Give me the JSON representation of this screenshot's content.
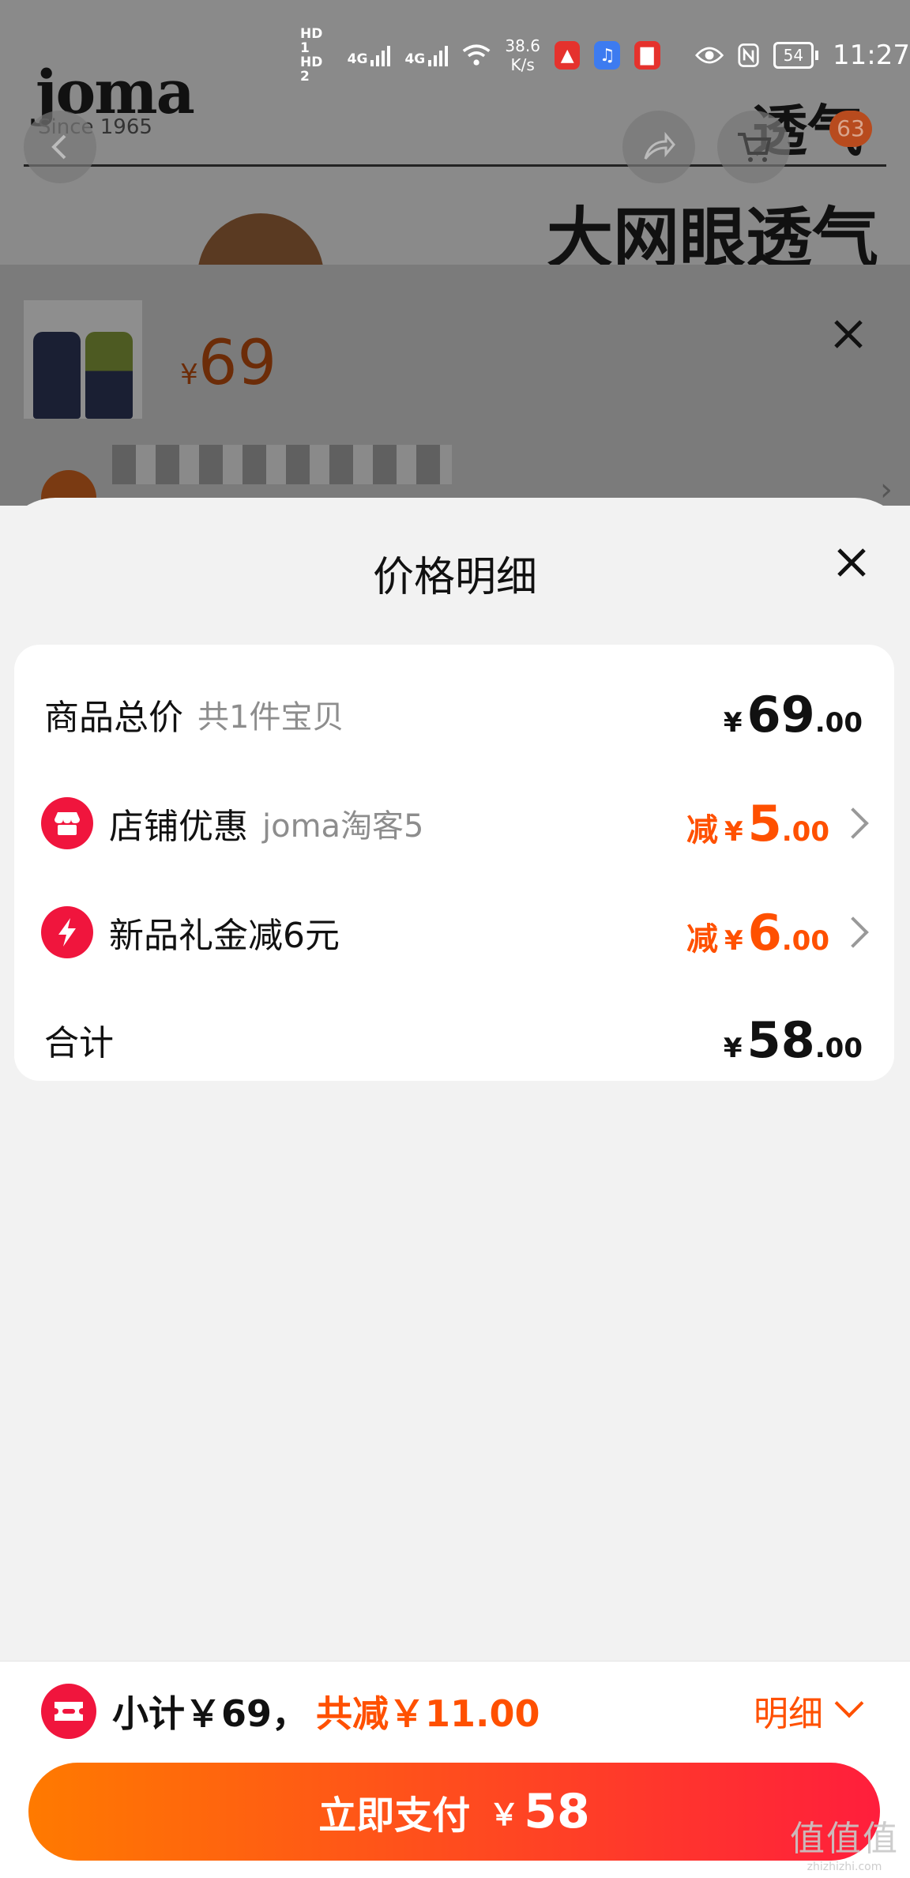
{
  "status_bar": {
    "hd1": "HD 1",
    "hd2": "HD 2",
    "net1": "4G",
    "net2": "4G",
    "speed": "38.6",
    "speed_unit": "K/s",
    "battery": "54",
    "time": "11:27"
  },
  "background": {
    "brand": "joma",
    "since": "Since 1965",
    "promo_top": "透气",
    "promo_main": "大网眼透气",
    "cart_count": "63",
    "currency": "¥",
    "price": "69"
  },
  "sheet": {
    "title": "价格明细"
  },
  "breakdown": {
    "total": {
      "label": "商品总价",
      "sub": "共1件宝贝",
      "currency": "¥",
      "int": "69",
      "dec": ".00"
    },
    "shop_discount": {
      "label": "店铺优惠",
      "sub": "joma淘客5",
      "prefix": "减",
      "currency": "¥",
      "int": "5",
      "dec": ".00"
    },
    "new_gift": {
      "label": "新品礼金减6元",
      "prefix": "减",
      "currency": "¥",
      "int": "6",
      "dec": ".00"
    },
    "sum": {
      "label": "合计",
      "currency": "¥",
      "int": "58",
      "dec": ".00"
    }
  },
  "bottom": {
    "subtotal": "小计￥69，",
    "discount": "共减￥11.00",
    "detail": "明细",
    "pay_label": "立即支付",
    "pay_currency": "￥",
    "pay_amount": "58"
  },
  "watermark": {
    "main": "值值值",
    "site": "zhizhizhi.com"
  },
  "colors": {
    "accent": "#ff5000",
    "red": "#f0153d"
  }
}
